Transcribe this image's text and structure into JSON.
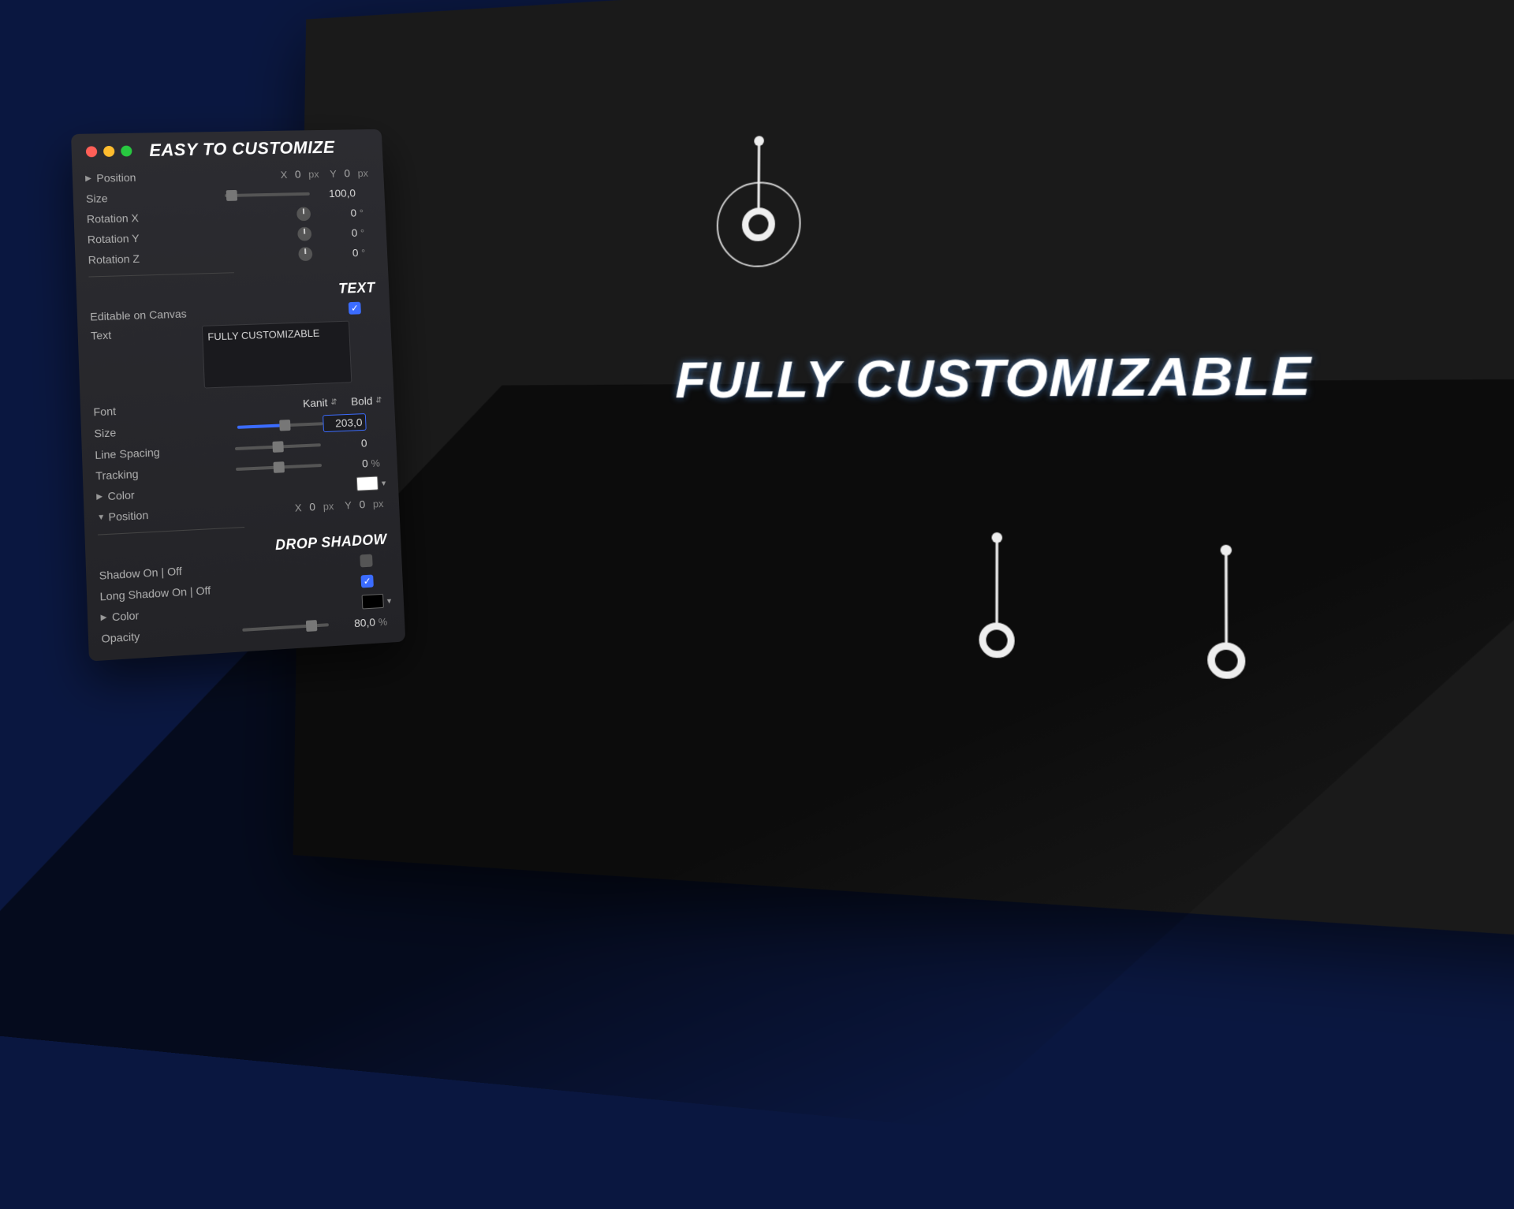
{
  "panel": {
    "title": "EASY TO CUSTOMIZE",
    "position": {
      "label": "Position",
      "x_label": "X",
      "x_value": "0",
      "x_unit": "px",
      "y_label": "Y",
      "y_value": "0",
      "y_unit": "px"
    },
    "size": {
      "label": "Size",
      "value": "100,0"
    },
    "rotation_x": {
      "label": "Rotation X",
      "value": "0",
      "unit": "°"
    },
    "rotation_y": {
      "label": "Rotation Y",
      "value": "0",
      "unit": "°"
    },
    "rotation_z": {
      "label": "Rotation Z",
      "value": "0",
      "unit": "°"
    },
    "text_section": "TEXT",
    "editable_on_canvas": {
      "label": "Editable on Canvas",
      "checked": true
    },
    "text": {
      "label": "Text",
      "value": "FULLY CUSTOMIZABLE"
    },
    "font": {
      "label": "Font",
      "family": "Kanit",
      "weight": "Bold"
    },
    "font_size": {
      "label": "Size",
      "value": "203,0"
    },
    "line_spacing": {
      "label": "Line Spacing",
      "value": "0"
    },
    "tracking": {
      "label": "Tracking",
      "value": "0",
      "unit": "%"
    },
    "color": {
      "label": "Color",
      "swatch": "#ffffff"
    },
    "text_position": {
      "label": "Position",
      "x_label": "X",
      "x_value": "0",
      "x_unit": "px",
      "y_label": "Y",
      "y_value": "0",
      "y_unit": "px"
    },
    "drop_shadow_section": "DROP SHADOW",
    "shadow_on": {
      "label": "Shadow On | Off",
      "checked": false
    },
    "long_shadow_on": {
      "label": "Long Shadow On | Off",
      "checked": true
    },
    "shadow_color": {
      "label": "Color",
      "swatch": "#000000"
    },
    "opacity": {
      "label": "Opacity",
      "value": "80,0",
      "unit": "%"
    }
  },
  "canvas": {
    "headline": "FULLY CUSTOMIZABLE"
  }
}
